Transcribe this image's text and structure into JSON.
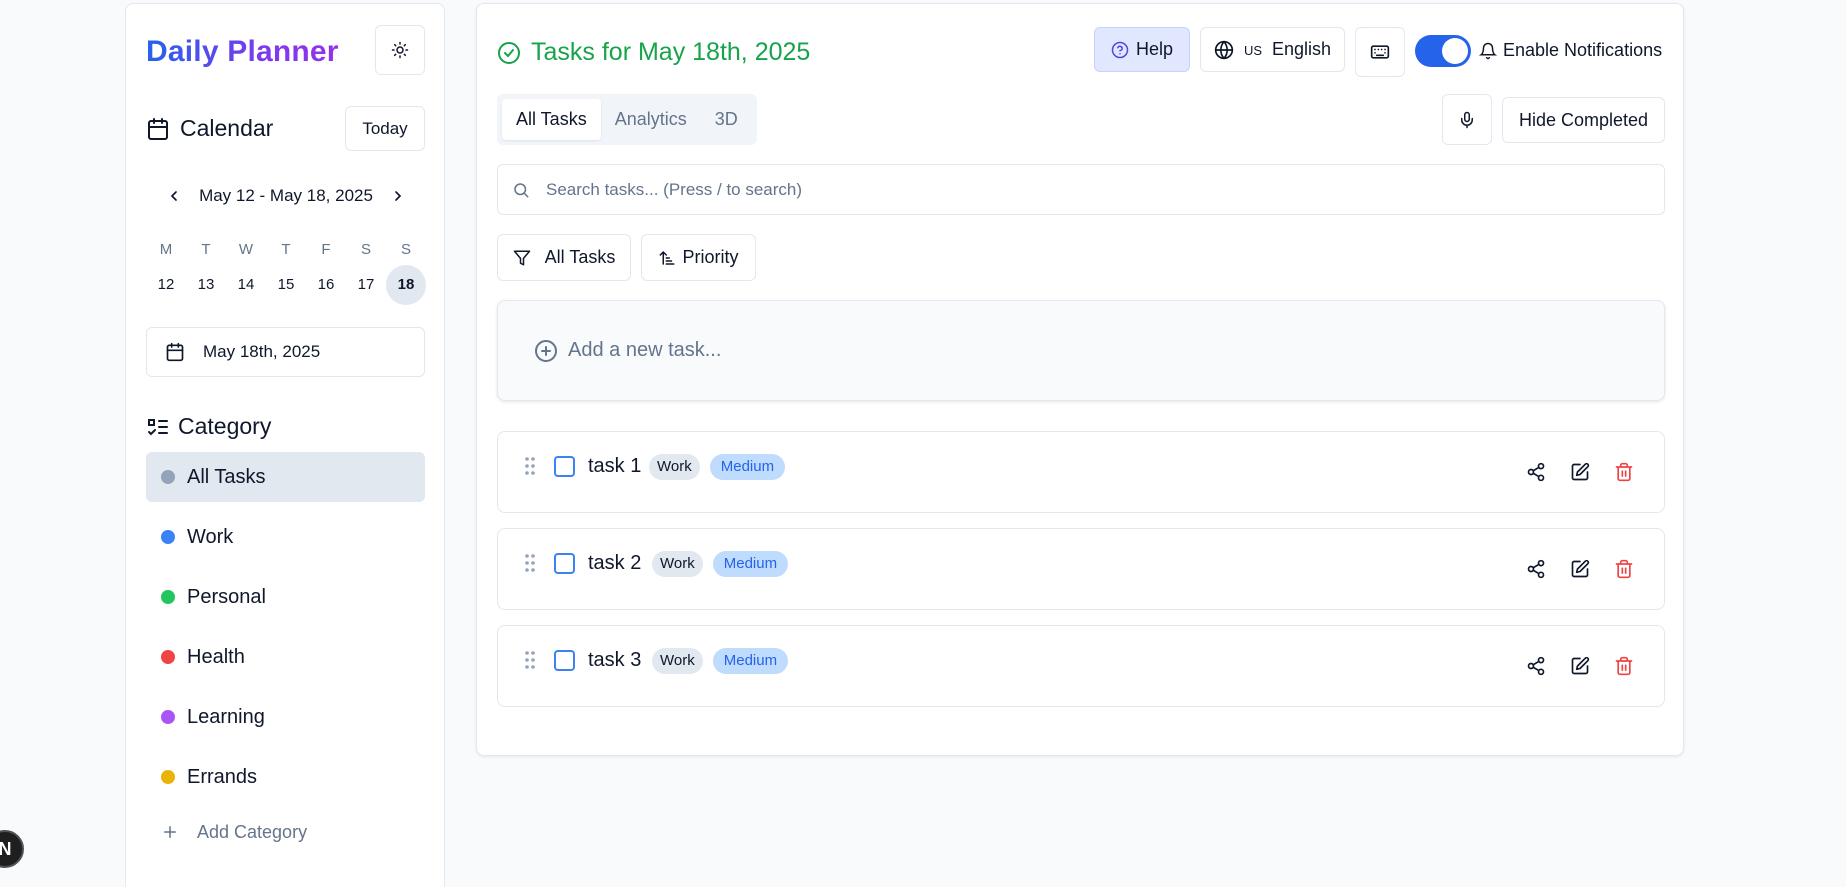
{
  "sidebar": {
    "brand": "Daily Planner",
    "calendar_label": "Calendar",
    "today_label": "Today",
    "week_range": "May 12 - May 18, 2025",
    "weekdays": [
      "M",
      "T",
      "W",
      "T",
      "F",
      "S",
      "S"
    ],
    "days": [
      "12",
      "13",
      "14",
      "15",
      "16",
      "17",
      "18"
    ],
    "selected_day": "18",
    "selected_date": "May 18th, 2025",
    "category_label": "Category",
    "categories": [
      {
        "label": "All Tasks",
        "color": "#94a3b8",
        "active": true
      },
      {
        "label": "Work",
        "color": "#3b82f6"
      },
      {
        "label": "Personal",
        "color": "#22c55e"
      },
      {
        "label": "Health",
        "color": "#ef4444"
      },
      {
        "label": "Learning",
        "color": "#a855f7"
      },
      {
        "label": "Errands",
        "color": "#eab308"
      }
    ],
    "add_category_label": "Add Category"
  },
  "header": {
    "title": "Tasks for May 18th, 2025",
    "help_label": "Help",
    "lang_code": "US",
    "lang_label": "English",
    "notifications_label": "Enable Notifications",
    "notifications_enabled": true
  },
  "tabs": [
    {
      "label": "All Tasks",
      "active": true
    },
    {
      "label": "Analytics"
    },
    {
      "label": "3D"
    }
  ],
  "toolbar": {
    "hide_completed_label": "Hide Completed",
    "filter_label": "All Tasks",
    "sort_label": "Priority"
  },
  "search": {
    "placeholder": "Search tasks... (Press / to search)",
    "value": ""
  },
  "add_task_placeholder": "Add a new task...",
  "tasks": [
    {
      "name": "task 1",
      "category": "Work",
      "priority": "Medium",
      "done": false
    },
    {
      "name": "task 2",
      "category": "Work",
      "priority": "Medium",
      "done": false
    },
    {
      "name": "task 3",
      "category": "Work",
      "priority": "Medium",
      "done": false
    }
  ],
  "colors": {
    "accent": "#2563eb",
    "title_green": "#16a34a",
    "delete_red": "#ef4444"
  },
  "fab_label": "N"
}
